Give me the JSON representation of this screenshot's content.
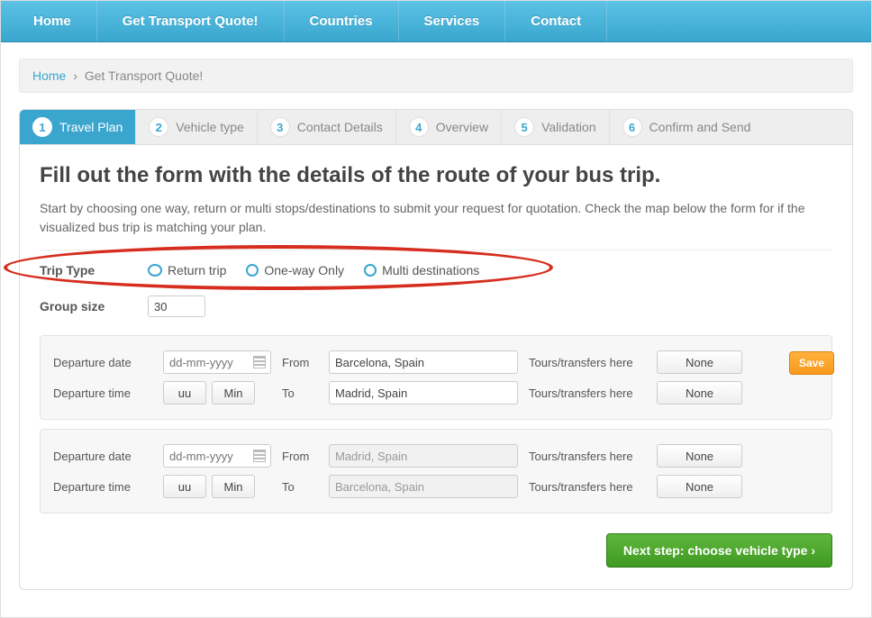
{
  "nav": {
    "items": [
      "Home",
      "Get Transport Quote!",
      "Countries",
      "Services",
      "Contact"
    ]
  },
  "breadcrumb": {
    "home": "Home",
    "sep": "›",
    "current": "Get Transport Quote!"
  },
  "steps": [
    {
      "num": "1",
      "label": "Travel Plan",
      "active": true
    },
    {
      "num": "2",
      "label": "Vehicle type"
    },
    {
      "num": "3",
      "label": "Contact Details"
    },
    {
      "num": "4",
      "label": "Overview"
    },
    {
      "num": "5",
      "label": "Validation"
    },
    {
      "num": "6",
      "label": "Confirm and Send"
    }
  ],
  "heading": "Fill out the form with the details of the route of your bus trip.",
  "intro": "Start by choosing one way, return or multi stops/destinations to submit your request for quotation. Check the map below the form for if the visualized bus trip is matching your plan.",
  "trip_type": {
    "label": "Trip Type",
    "options": [
      {
        "key": "return",
        "label": "Return trip",
        "selected": true
      },
      {
        "key": "oneway",
        "label": "One-way Only",
        "selected": false
      },
      {
        "key": "multi",
        "label": "Multi destinations",
        "selected": false
      }
    ]
  },
  "group_size": {
    "label": "Group size",
    "value": "30"
  },
  "leg_labels": {
    "dep_date": "Departure date",
    "dep_time": "Departure time",
    "from": "From",
    "to": "To",
    "tours": "Tours/transfers here",
    "date_ph": "dd-mm-yyyy",
    "hh": "uu",
    "mm": "Min",
    "none": "None"
  },
  "legs": [
    {
      "from": "Barcelona, Spain",
      "to": "Madrid, Spain",
      "editable": true
    },
    {
      "from": "Madrid, Spain",
      "to": "Barcelona, Spain",
      "editable": false
    }
  ],
  "buttons": {
    "save": "Save",
    "next": "Next step: choose vehicle type ›"
  }
}
